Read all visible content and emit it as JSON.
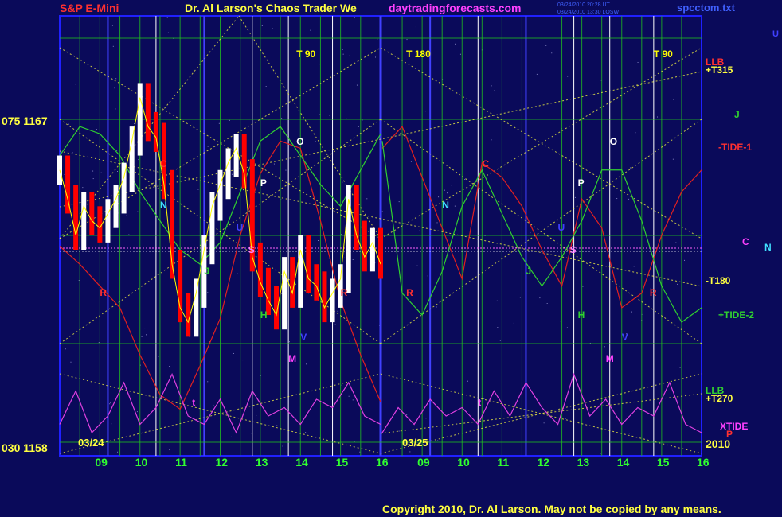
{
  "header": {
    "symbol": "S&P E-Mini",
    "title": "Dr. Al Larson's Chaos Trader We",
    "website": "daytradingforecasts.com",
    "timestamp_1": "03/24/2010 20:28 UT",
    "timestamp_2": "03/24/2010 13:30 LOSW",
    "filename": "spcctom.txt",
    "corner_mark": "U"
  },
  "footer": {
    "copyright": "Copyright 2010, Dr. Al Larson. May not be copied by any means."
  },
  "colors": {
    "background": "#0a0a5a",
    "plot_border": "#2020ff",
    "gridline_green": "#20c020",
    "gridline_blue": "#4040ff",
    "gridline_white": "#ffffff",
    "gridline_yellow": "#ffff40",
    "price_up": "#ffffff",
    "price_down": "#ff0000",
    "field_red": "#e02020",
    "field_green": "#30d030",
    "xtide_magenta": "#e040e0",
    "yellow": "#ffff00",
    "title_red": "#ff3030",
    "title_yellow": "#ffff40",
    "website_magenta": "#ff40ff",
    "filename_blue": "#4060ff"
  },
  "chart_data": {
    "type": "line",
    "y_axis_labels": [
      {
        "text": "075  1167",
        "value": 1167
      },
      {
        "text": "030  1158",
        "value": 1158
      }
    ],
    "ylim": [
      1158,
      1167
    ],
    "date_labels": [
      "03/24",
      "03/25"
    ],
    "year_label": "2010",
    "x_ticks": [
      "09",
      "10",
      "11",
      "12",
      "13",
      "14",
      "15",
      "16",
      "09",
      "10",
      "11",
      "12",
      "13",
      "14",
      "15",
      "16"
    ],
    "right_labels": [
      {
        "text": "LLB",
        "color": "#ff3030"
      },
      {
        "text": "+T315",
        "color": "#ffff40"
      },
      {
        "text": "J",
        "color": "#30d030"
      },
      {
        "text": "-TIDE-1",
        "color": "#ff3030"
      },
      {
        "text": "C",
        "color": "#ff40ff"
      },
      {
        "text": "N",
        "color": "#40e0ff"
      },
      {
        "text": "-T180",
        "color": "#ffff40"
      },
      {
        "text": "+TIDE-2",
        "color": "#30d030"
      },
      {
        "text": "LLB",
        "color": "#30d030"
      },
      {
        "text": "+T270",
        "color": "#ffff40"
      },
      {
        "text": "XTIDE",
        "color": "#ff40ff"
      },
      {
        "text": "P",
        "color": "#ff3030"
      }
    ],
    "time_markers": [
      {
        "text": "T  90",
        "day": 0,
        "hour": 13.9
      },
      {
        "text": "T  180",
        "day": 1,
        "hour": 8.6
      },
      {
        "text": "T  90",
        "day": 1,
        "hour": 14.8
      }
    ],
    "planet_markers": [
      {
        "text": "C",
        "day": 0,
        "hour": 10.5,
        "color": "#ff3030"
      },
      {
        "text": "N",
        "day": 0,
        "hour": 10.5,
        "color": "#40e0ff"
      },
      {
        "text": "J",
        "day": 0,
        "hour": 11.6,
        "color": "#30d030"
      },
      {
        "text": "U",
        "day": 0,
        "hour": 12.4,
        "color": "#4040ff"
      },
      {
        "text": "S",
        "day": 0,
        "hour": 12.7,
        "color": "#ff80ff"
      },
      {
        "text": "P",
        "day": 0,
        "hour": 13.0,
        "color": "#ffffff"
      },
      {
        "text": "O",
        "day": 0,
        "hour": 13.9,
        "color": "#ffffff"
      },
      {
        "text": "H",
        "day": 0,
        "hour": 13.0,
        "color": "#30d030"
      },
      {
        "text": "M",
        "day": 0,
        "hour": 13.7,
        "color": "#ff40ff"
      },
      {
        "text": "V",
        "day": 0,
        "hour": 14.0,
        "color": "#4040ff"
      },
      {
        "text": "R",
        "day": 0,
        "hour": 9.0,
        "color": "#ff3030"
      },
      {
        "text": "R",
        "day": 0,
        "hour": 15.0,
        "color": "#ff3030"
      },
      {
        "text": "t",
        "day": 0,
        "hour": 11.3,
        "color": "#ff40ff"
      },
      {
        "text": "R",
        "day": 1,
        "hour": 8.6,
        "color": "#ff3030"
      },
      {
        "text": "N",
        "day": 1,
        "hour": 9.5,
        "color": "#40e0ff"
      },
      {
        "text": "C",
        "day": 1,
        "hour": 10.5,
        "color": "#ff3030"
      },
      {
        "text": "J",
        "day": 1,
        "hour": 11.6,
        "color": "#30d030"
      },
      {
        "text": "U",
        "day": 1,
        "hour": 12.4,
        "color": "#4040ff"
      },
      {
        "text": "S",
        "day": 1,
        "hour": 12.7,
        "color": "#ff80ff"
      },
      {
        "text": "P",
        "day": 1,
        "hour": 12.9,
        "color": "#ffffff"
      },
      {
        "text": "O",
        "day": 1,
        "hour": 13.7,
        "color": "#ffffff"
      },
      {
        "text": "H",
        "day": 1,
        "hour": 12.9,
        "color": "#30d030"
      },
      {
        "text": "M",
        "day": 1,
        "hour": 13.6,
        "color": "#ff40ff"
      },
      {
        "text": "V",
        "day": 1,
        "hour": 14.0,
        "color": "#4040ff"
      },
      {
        "text": "R",
        "day": 1,
        "hour": 14.7,
        "color": "#ff3030"
      },
      {
        "text": "t",
        "day": 1,
        "hour": 10.4,
        "color": "#ff40ff"
      }
    ],
    "price_series": {
      "name": "",
      "x_hours": [
        8.0,
        8.2,
        8.4,
        8.6,
        8.8,
        9.0,
        9.2,
        9.4,
        9.6,
        9.8,
        10.0,
        10.2,
        10.4,
        10.6,
        10.8,
        11.0,
        11.2,
        11.4,
        11.6,
        11.8,
        12.0,
        12.2,
        12.4,
        12.6,
        12.8,
        13.0,
        13.2,
        13.4,
        13.6,
        13.8,
        14.0,
        14.2,
        14.4,
        14.6,
        14.8,
        15.0,
        15.2,
        15.4,
        15.6,
        15.8,
        16.0
      ],
      "values": [
        1165.6,
        1164.8,
        1163.8,
        1164.6,
        1164.2,
        1164.0,
        1164.4,
        1164.8,
        1165.4,
        1166.4,
        1167.6,
        1166.8,
        1166.5,
        1165.2,
        1163.0,
        1161.8,
        1161.4,
        1162.2,
        1163.4,
        1164.6,
        1165.2,
        1165.8,
        1166.2,
        1165.5,
        1163.2,
        1162.5,
        1162.0,
        1161.6,
        1162.8,
        1162.2,
        1163.4,
        1162.6,
        1162.4,
        1161.8,
        1162.2,
        1162.6,
        1164.8,
        1163.8,
        1163.2,
        1163.6,
        1163.0
      ]
    },
    "series": [
      {
        "name": "",
        "color": "#e02020",
        "day": 0,
        "x_hours": [
          8.0,
          8.5,
          9.0,
          9.5,
          10.0,
          10.5,
          11.0,
          11.5,
          12.0,
          12.5,
          13.0,
          13.5,
          14.0,
          14.5,
          15.0,
          15.5,
          16.0
        ],
        "values": [
          1163.5,
          1163.0,
          1162.4,
          1161.8,
          1160.5,
          1159.4,
          1159.0,
          1160.2,
          1161.5,
          1163.8,
          1165.5,
          1166.4,
          1166.2,
          1164.2,
          1162.0,
          1160.5,
          1159.2
        ]
      },
      {
        "name": "",
        "color": "#e02020",
        "day": 1,
        "x_hours": [
          8.0,
          8.5,
          9.0,
          9.5,
          10.0,
          10.5,
          11.0,
          11.5,
          12.0,
          12.5,
          13.0,
          13.5,
          14.0,
          14.5,
          15.0,
          15.5,
          16.0
        ],
        "values": [
          1166.2,
          1166.8,
          1165.4,
          1164.0,
          1162.6,
          1165.8,
          1165.4,
          1164.6,
          1163.4,
          1162.4,
          1164.8,
          1164.0,
          1161.8,
          1162.2,
          1163.8,
          1165.0,
          1165.6
        ]
      },
      {
        "name": "",
        "color": "#30d030",
        "day": 0,
        "x_hours": [
          8.0,
          8.5,
          9.0,
          9.5,
          10.0,
          10.5,
          11.0,
          11.5,
          12.0,
          12.5,
          13.0,
          13.5,
          14.0,
          14.5,
          15.0,
          15.5,
          16.0
        ],
        "values": [
          1166.0,
          1166.8,
          1166.6,
          1166.0,
          1165.0,
          1164.2,
          1163.4,
          1163.0,
          1163.6,
          1165.0,
          1166.4,
          1166.8,
          1166.0,
          1165.2,
          1164.6,
          1165.6,
          1166.6
        ]
      },
      {
        "name": "",
        "color": "#30d030",
        "day": 1,
        "x_hours": [
          8.0,
          8.5,
          9.0,
          9.5,
          10.0,
          10.5,
          11.0,
          11.5,
          12.0,
          12.5,
          13.0,
          13.5,
          14.0,
          14.5,
          15.0,
          15.5,
          16.0
        ],
        "values": [
          1166.4,
          1162.2,
          1161.6,
          1162.8,
          1164.6,
          1165.6,
          1164.4,
          1163.2,
          1162.4,
          1163.2,
          1164.2,
          1165.6,
          1165.6,
          1164.2,
          1162.4,
          1161.4,
          1161.8
        ]
      }
    ],
    "xtide": {
      "name": "XTIDE",
      "color": "#e040e0",
      "ylim": [
        0,
        1
      ],
      "x_hours_day0": [
        8.0,
        8.4,
        8.8,
        9.2,
        9.6,
        10.0,
        10.4,
        10.8,
        11.2,
        11.6,
        12.0,
        12.4,
        12.8,
        13.2,
        13.6,
        14.0,
        14.4,
        14.8,
        15.2,
        15.6,
        16.0
      ],
      "values_day0": [
        0.3,
        0.7,
        0.2,
        0.4,
        0.8,
        0.3,
        0.5,
        0.9,
        0.4,
        0.3,
        0.6,
        0.2,
        0.7,
        0.4,
        0.5,
        0.3,
        0.6,
        0.5,
        0.8,
        0.4,
        0.3
      ],
      "x_hours_day1": [
        8.0,
        8.4,
        8.8,
        9.2,
        9.6,
        10.0,
        10.4,
        10.8,
        11.2,
        11.6,
        12.0,
        12.4,
        12.8,
        13.2,
        13.6,
        14.0,
        14.4,
        14.8,
        15.2,
        15.6,
        16.0
      ],
      "values_day1": [
        0.2,
        0.5,
        0.3,
        0.6,
        0.4,
        0.5,
        0.3,
        0.7,
        0.4,
        0.8,
        0.5,
        0.3,
        0.9,
        0.4,
        0.6,
        0.3,
        0.5,
        0.4,
        0.8,
        0.3,
        0.2
      ]
    }
  }
}
